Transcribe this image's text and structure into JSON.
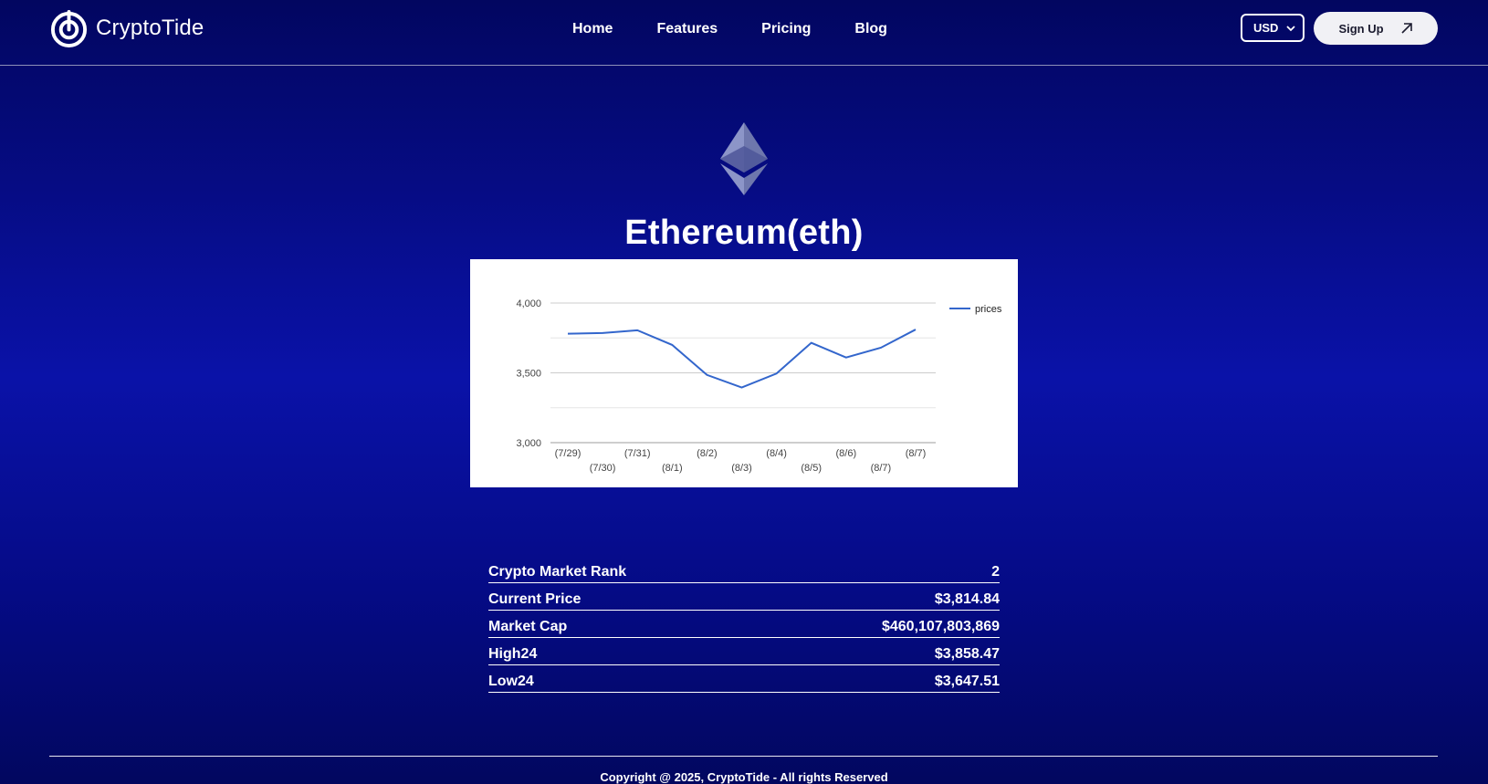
{
  "brand": {
    "name": "CryptoTide"
  },
  "nav": {
    "links": [
      "Home",
      "Features",
      "Pricing",
      "Blog"
    ]
  },
  "currency": {
    "selected": "USD"
  },
  "signup": {
    "label": "Sign Up"
  },
  "coin": {
    "title": "Ethereum(eth)"
  },
  "chart_data": {
    "type": "line",
    "x": [
      "(7/29)",
      "(7/30)",
      "(7/31)",
      "(8/1)",
      "(8/2)",
      "(8/3)",
      "(8/4)",
      "(8/5)",
      "(8/6)",
      "(8/7)",
      "(8/7)"
    ],
    "series": [
      {
        "name": "prices",
        "values": [
          3780,
          3785,
          3805,
          3700,
          3485,
          3395,
          3495,
          3715,
          3610,
          3680,
          3810
        ]
      }
    ],
    "ylim": [
      3000,
      4000
    ],
    "yticks": [
      "3,000",
      "3,500",
      "4,000"
    ],
    "grid": true,
    "legend_position": "right",
    "line_color": "#3366cc"
  },
  "stats": [
    {
      "label": "Crypto Market Rank",
      "value": "2"
    },
    {
      "label": "Current Price",
      "value": "$3,814.84"
    },
    {
      "label": "Market Cap",
      "value": "$460,107,803,869"
    },
    {
      "label": "High24",
      "value": "$3,858.47"
    },
    {
      "label": "Low24",
      "value": "$3,647.51"
    }
  ],
  "footer": {
    "copyright": "Copyright @ 2025, CryptoTide - All rights Reserved"
  }
}
